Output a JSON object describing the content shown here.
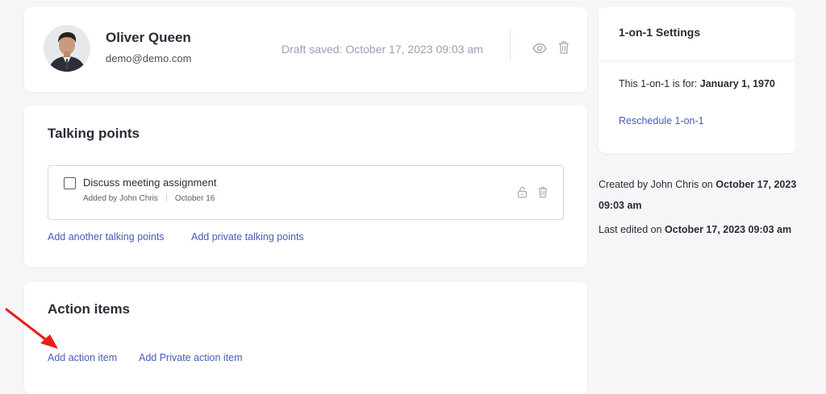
{
  "profile": {
    "name": "Oliver Queen",
    "email": "demo@demo.com",
    "draft_status": "Draft saved: October 17, 2023 09:03 am"
  },
  "talking_points": {
    "title": "Talking points",
    "items": [
      {
        "text": "Discuss meeting assignment",
        "added_by": "Added by John Chris",
        "date": "October 16"
      }
    ],
    "add_link": "Add another talking points",
    "add_private_link": "Add private talking points"
  },
  "action_items": {
    "title": "Action items",
    "add_link": "Add action item",
    "add_private_link": "Add Private action item"
  },
  "settings": {
    "title": "1-on-1 Settings",
    "for_label": "This 1-on-1 is for:",
    "for_date": "January 1, 1970",
    "reschedule_link": "Reschedule 1-on-1"
  },
  "meta": {
    "created_prefix": "Created by John Chris on",
    "created_date": "October 17, 2023 09:03 am",
    "edited_prefix": "Last edited on",
    "edited_date": "October 17, 2023 09:03 am"
  },
  "colors": {
    "link": "#4a5bb8",
    "annotation_arrow": "#e8201c"
  }
}
